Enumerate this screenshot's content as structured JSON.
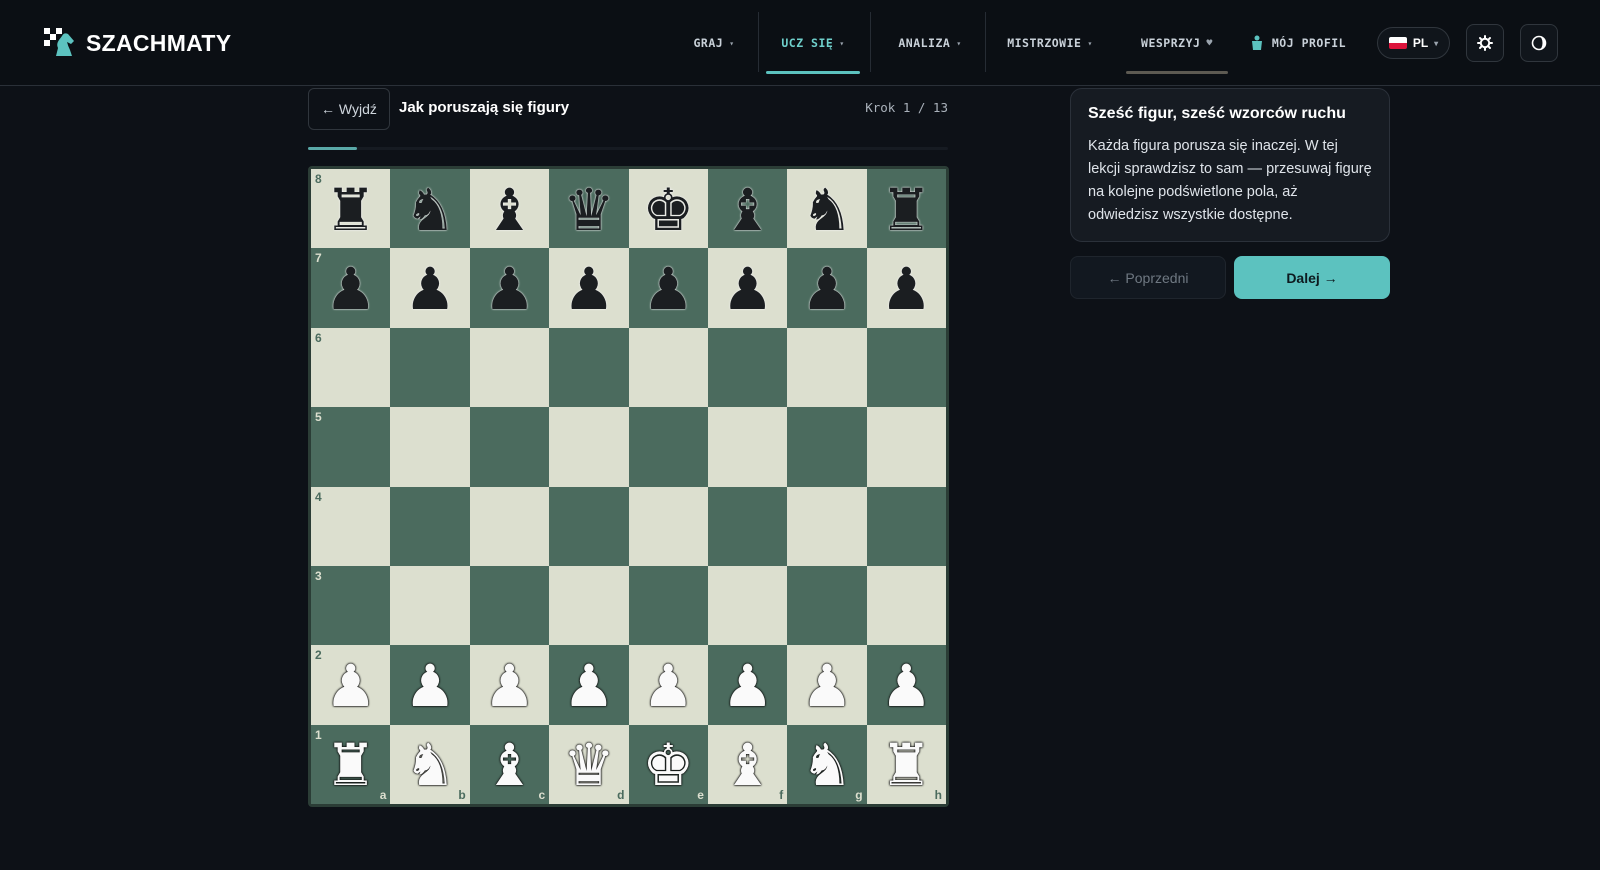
{
  "brand": {
    "name": "SZACHMATY"
  },
  "nav": {
    "items": [
      {
        "label": "GRAJ",
        "caret": "▾"
      },
      {
        "label": "UCZ SIĘ",
        "caret": "▾"
      },
      {
        "label": "ANALIZA",
        "caret": "▾"
      },
      {
        "label": "MISTRZOWIE",
        "caret": "▾"
      },
      {
        "label": "WESPRZYJ",
        "caret": "♥"
      }
    ],
    "profile_label": "MÓJ PROFIL",
    "language": "PL",
    "language_caret": "▾",
    "active_index": 1
  },
  "lesson": {
    "exit_label": "← Wyjdź",
    "title": "Jak poruszają się figury",
    "step_label": "Krok 1 / 13",
    "progress": 0.077
  },
  "board": {
    "ranks": [
      "8",
      "7",
      "6",
      "5",
      "4",
      "3",
      "2",
      "1"
    ],
    "files": [
      "a",
      "b",
      "c",
      "d",
      "e",
      "f",
      "g",
      "h"
    ],
    "position": [
      [
        "bR",
        "bN",
        "bB",
        "bQ",
        "bK",
        "bB",
        "bN",
        "bR"
      ],
      [
        "bP",
        "bP",
        "bP",
        "bP",
        "bP",
        "bP",
        "bP",
        "bP"
      ],
      [
        "",
        "",
        "",
        "",
        "",
        "",
        "",
        ""
      ],
      [
        "",
        "",
        "",
        "",
        "",
        "",
        "",
        ""
      ],
      [
        "",
        "",
        "",
        "",
        "",
        "",
        "",
        ""
      ],
      [
        "",
        "",
        "",
        "",
        "",
        "",
        "",
        ""
      ],
      [
        "wP",
        "wP",
        "wP",
        "wP",
        "wP",
        "wP",
        "wP",
        "wP"
      ],
      [
        "wR",
        "wN",
        "wB",
        "wQ",
        "wK",
        "wB",
        "wN",
        "wR"
      ]
    ]
  },
  "card": {
    "title": "Sześć figur, sześć wzorców ruchu",
    "body": "Każda figura porusza się inaczej. W tej lekcji sprawdzisz to sam — przesuwaj figurę na kolejne podświetlone pola, aż odwiedzisz wszystkie dostępne."
  },
  "controls": {
    "prev_label": "← Poprzedni",
    "next_label": "Dalej →"
  },
  "colors": {
    "accent": "#5cc2bf",
    "light_square": "#dcdfcf",
    "dark_square": "#4b6b5e",
    "background": "#0d1117"
  },
  "icons": {
    "settings": "gear-icon",
    "theme": "theme-toggle-icon",
    "profile": "user-icon",
    "logo": "knight-logo-icon"
  }
}
